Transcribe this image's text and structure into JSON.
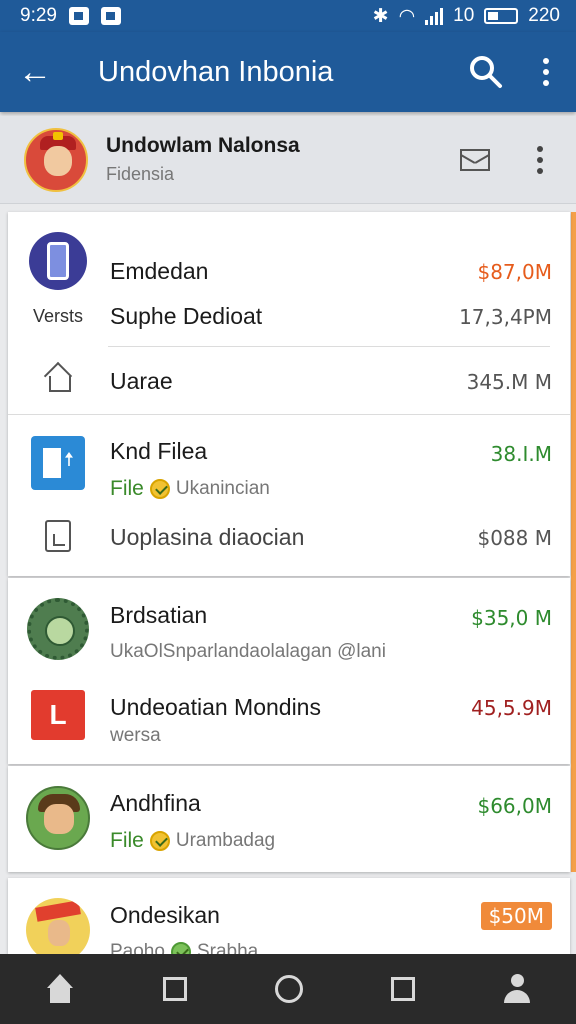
{
  "status_bar": {
    "time": "9:29",
    "battery_text": "10",
    "clock_right": "220"
  },
  "app_bar": {
    "title": "Undovhan Inbonia"
  },
  "profile": {
    "name": "Undowlam Nalonsa",
    "subtitle": "Fidensia"
  },
  "cards": [
    {
      "rows": [
        {
          "icon": "phone-icon",
          "primary": "Emdedan",
          "value": "$87,0M",
          "value_color": "#e65c1c"
        },
        {
          "lead_text": "Versts",
          "primary": "Suphe Dedioat",
          "value": "17,3,4PM",
          "value_color": "#555555"
        },
        {
          "icon": "home-outline-icon",
          "primary": "Uarae",
          "value": "345.M M",
          "value_color": "#555555"
        }
      ]
    },
    {
      "rows": [
        {
          "icon": "document-upload-icon",
          "primary": "Knd Filea",
          "secondary_label": "File",
          "secondary": "Ukanincian",
          "value": "38.I.M",
          "value_color": "#2e8b2e"
        },
        {
          "icon": "file-outline-icon",
          "primary": "Uoplasina diaocian",
          "value": "$088 M",
          "value_color": "#555555"
        }
      ]
    },
    {
      "rows": [
        {
          "icon": "gear-icon",
          "primary": "Brdsatian",
          "secondary": "UkaOlSnparlandaolalagan @lani",
          "value": "$35,0 M",
          "value_color": "#2e8b2e"
        },
        {
          "icon": "red-l-icon",
          "icon_text": "L",
          "primary": "Undeoatian Mondins",
          "secondary": "wersa",
          "value": "45,5.9M",
          "value_color": "#a02020"
        }
      ]
    },
    {
      "rows": [
        {
          "icon": "character-avatar-icon",
          "primary": "Andhfina",
          "secondary_label": "File",
          "secondary": "Urambadag",
          "value": "$66,0M",
          "value_color": "#2e8b2e"
        }
      ]
    },
    {
      "rows": [
        {
          "icon": "flag-avatar-icon",
          "primary": "Ondesikan",
          "secondary": "Paoho",
          "secondary_2": "Srabha",
          "value": "$50M",
          "value_color": "#ffffff"
        }
      ]
    }
  ]
}
